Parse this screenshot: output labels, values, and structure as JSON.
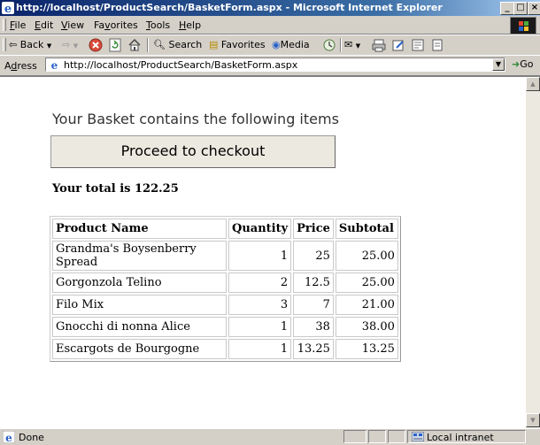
{
  "window": {
    "title": "http://localhost/ProductSearch/BasketForm.aspx - Microsoft Internet Explorer",
    "minimize": "_",
    "maximize": "□",
    "close": "×"
  },
  "menu": {
    "items": [
      {
        "first": "F",
        "rest": "ile"
      },
      {
        "first": "E",
        "rest": "dit"
      },
      {
        "first": "V",
        "rest": "iew"
      },
      {
        "first": "F",
        "rest": "avorites",
        "pre": "Fa",
        "ul": "v",
        "post": "orites"
      },
      {
        "first": "T",
        "rest": "ools"
      },
      {
        "first": "H",
        "rest": "elp"
      }
    ]
  },
  "toolbar": {
    "back": "⇦ Back",
    "search": "Search",
    "favorites": "Favorites",
    "media": "Media"
  },
  "address": {
    "label_ul": "d",
    "label_pre": "A",
    "label_post": "ress",
    "url": "http://localhost/ProductSearch/BasketForm.aspx",
    "go": "Go"
  },
  "page": {
    "heading": "Your Basket contains the following items",
    "checkout_button": "Proceed to checkout",
    "total": "Your total is 122.25",
    "table": {
      "headers": [
        "Product Name",
        "Quantity",
        "Price",
        "Subtotal"
      ],
      "rows": [
        {
          "name": "Grandma's Boysenberry Spread",
          "quantity": "1",
          "price": "25",
          "subtotal": "25.00"
        },
        {
          "name": "Gorgonzola Telino",
          "quantity": "2",
          "price": "12.5",
          "subtotal": "25.00"
        },
        {
          "name": "Filo Mix",
          "quantity": "3",
          "price": "7",
          "subtotal": "21.00"
        },
        {
          "name": "Gnocchi di nonna Alice",
          "quantity": "1",
          "price": "38",
          "subtotal": "38.00"
        },
        {
          "name": "Escargots de Bourgogne",
          "quantity": "1",
          "price": "13.25",
          "subtotal": "13.25"
        }
      ]
    }
  },
  "status": {
    "text": "Done",
    "zone": "Local intranet"
  },
  "colors": {
    "titlebar": "#0a246a",
    "chrome": "#d4d0c8"
  }
}
